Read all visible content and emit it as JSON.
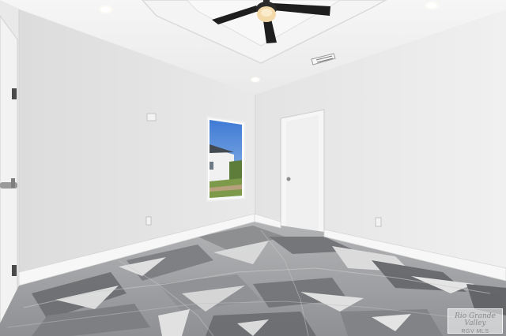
{
  "photo": {
    "subject": "empty-bedroom-interior",
    "colors": {
      "wall_left": "#e6e6e6",
      "wall_back": "#dedede",
      "wall_right": "#ececec",
      "ceiling": "#f1f1f1",
      "trim": "#f7f7f7",
      "floor_base": "#a9aaab",
      "floor_dark": "#5f6163",
      "floor_light": "#e3e3e3",
      "sky": "#5a8fd8",
      "fan_blade": "#1e1e1e",
      "fan_light": "#f3d9a8"
    }
  },
  "watermark": {
    "script_text": "Rio Grande Valley",
    "mls_text": "RGV MLS"
  }
}
